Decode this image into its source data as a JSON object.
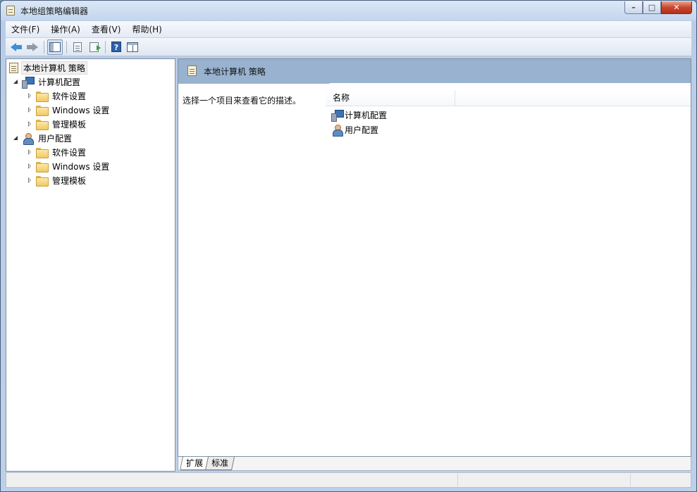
{
  "window": {
    "title": "本地组策略编辑器",
    "controls": {
      "minimize": "–",
      "maximize": "□",
      "close": "✕"
    }
  },
  "menu": [
    {
      "label": "文件(F)"
    },
    {
      "label": "操作(A)"
    },
    {
      "label": "查看(V)"
    },
    {
      "label": "帮助(H)"
    }
  ],
  "toolbar": {
    "icons": [
      "back-arrow-icon",
      "forward-arrow-icon",
      "show-hide-console-tree-icon",
      "properties-page-icon",
      "export-list-icon",
      "help-icon",
      "action-pane-icon"
    ]
  },
  "tree": {
    "root": "本地计算机 策略",
    "computer": {
      "label": "计算机配置",
      "children": [
        "软件设置",
        "Windows 设置",
        "管理模板"
      ]
    },
    "user": {
      "label": "用户配置",
      "children": [
        "软件设置",
        "Windows 设置",
        "管理模板"
      ]
    }
  },
  "details": {
    "header": "本地计算机 策略",
    "description": "选择一个项目来查看它的描述。",
    "column_name": "名称",
    "items": [
      "计算机配置",
      "用户配置"
    ]
  },
  "tabs": [
    "扩展",
    "标准"
  ],
  "colors": {
    "header_bg": "#98b2cf",
    "window_frame": "#bcd0ea",
    "close_button": "#c9462c"
  }
}
